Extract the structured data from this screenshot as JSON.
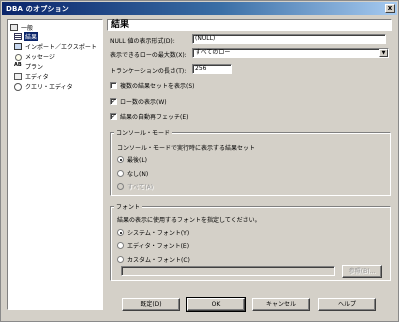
{
  "window": {
    "title": "DBA のオプション",
    "close_glyph": "x"
  },
  "tree": {
    "items": [
      {
        "label": "一般",
        "icon": "general-icon",
        "selected": false
      },
      {
        "label": "結果",
        "icon": "results-icon",
        "selected": true
      },
      {
        "label": "インポート／エクスポート",
        "icon": "import-export-icon",
        "selected": false
      },
      {
        "label": "メッセージ",
        "icon": "messages-icon",
        "selected": false
      },
      {
        "label": "プラン",
        "icon": "plan-icon",
        "selected": false
      },
      {
        "label": "エディタ",
        "icon": "editor-icon",
        "selected": false
      },
      {
        "label": "クエリ・エディタ",
        "icon": "query-editor-icon",
        "selected": false
      }
    ]
  },
  "panel": {
    "title": "結果",
    "null_format": {
      "label": "NULL 値の表示形式(D):",
      "value": "(NULL)"
    },
    "max_rows": {
      "label": "表示できるローの最大数(X):",
      "value": "すべてのロー",
      "arrow": "▼"
    },
    "truncation": {
      "label": "トランケーションの長さ(T):",
      "value": "256"
    },
    "checks": [
      {
        "label": "複数の結果セットを表示(S)",
        "checked": false
      },
      {
        "label": "ロー数の表示(W)",
        "checked": true
      },
      {
        "label": "結果の自動再フェッチ(E)",
        "checked": true
      }
    ],
    "check_mark": "✓",
    "console_group": {
      "title": "コンソール・モード",
      "description": "コンソール・モードで実行時に表示する結果セット",
      "options": [
        {
          "label": "最後(L)",
          "selected": true,
          "disabled": false
        },
        {
          "label": "なし(N)",
          "selected": false,
          "disabled": false
        },
        {
          "label": "すべて(A)",
          "selected": false,
          "disabled": true
        }
      ]
    },
    "font_group": {
      "title": "フォント",
      "description": "結果の表示に使用するフォントを指定してください。",
      "options": [
        {
          "label": "システム・フォント(Y)",
          "selected": true
        },
        {
          "label": "エディタ・フォント(E)",
          "selected": false
        },
        {
          "label": "カスタム・フォント(C)",
          "selected": false
        }
      ],
      "custom_font_value": "",
      "browse_label": "参照(B)..."
    }
  },
  "buttons": {
    "default": "既定(D)",
    "ok": "OK",
    "cancel": "キャンセル",
    "help": "ヘルプ"
  }
}
